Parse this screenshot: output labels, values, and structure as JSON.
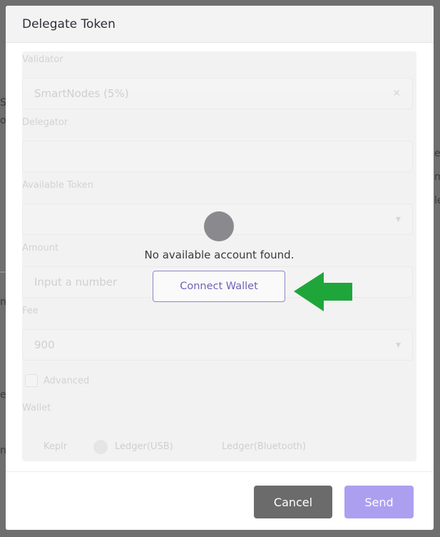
{
  "background": {
    "fragments": [
      "S",
      "o",
      "ei",
      "m",
      "le",
      "n",
      "e",
      "n"
    ]
  },
  "modal": {
    "title": "Delegate Token",
    "form": {
      "validator_label": "Validator",
      "validator_value": "SmartNodes (5%)",
      "validator_clear": "✕",
      "delegator_label": "Delegator",
      "available_label": "Available Token",
      "amount_label": "Amount",
      "amount_placeholder": "Input a number",
      "fee_label": "Fee",
      "fee_value": "900",
      "advanced_label": "Advanced",
      "wallet_label": "Wallet",
      "wallet_options": [
        "Keplr",
        "Ledger(USB)",
        "Ledger(Bluetooth)"
      ]
    },
    "overlay": {
      "message": "No available account found.",
      "connect_label": "Connect Wallet"
    },
    "footer": {
      "cancel_label": "Cancel",
      "send_label": "Send"
    }
  },
  "colors": {
    "accent": "#6f63b8",
    "send_button": "#ad9ff0",
    "cancel_button": "#6b6b6b",
    "arrow": "#1fa63a"
  }
}
